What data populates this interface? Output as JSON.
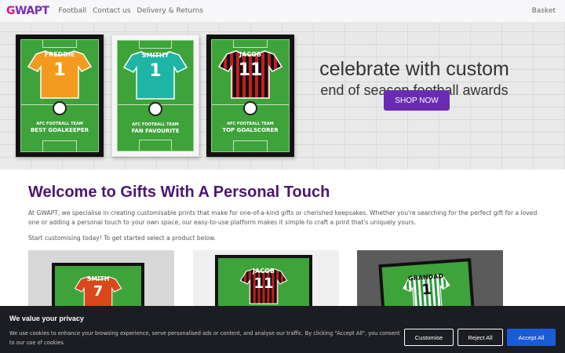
{
  "nav": {
    "logo_g": "G",
    "logo_rest": "WAPT",
    "links": [
      "Football",
      "Contact us",
      "Delivery & Returns"
    ],
    "basket": "Basket"
  },
  "hero": {
    "frames": [
      {
        "name": "FREDDIE",
        "number": "1",
        "team": "AFC FOOTBALL TEAM",
        "award": "BEST GOALKEEPER",
        "shirt_color": "#f39a1f",
        "frame": "black"
      },
      {
        "name": "SMITHY",
        "number": "1",
        "team": "AFC FOOTBALL TEAM",
        "award": "FAN FAVOURITE",
        "shirt_color": "#1fb5a6",
        "frame": "white"
      },
      {
        "name": "JACOB",
        "number": "11",
        "team": "AFC FOOTBALL TEAM",
        "award": "TOP GOALSCORER",
        "shirt_color": "#c0201f",
        "frame": "black"
      }
    ],
    "heading": "celebrate with custom",
    "subheading": "end of season football awards",
    "cta": "SHOP NOW"
  },
  "welcome": {
    "title": "Welcome to Gifts With A Personal Touch",
    "paragraph": "At GWAPT, we specialise in creating customisable prints that make for one-of-a-kind gifts or cherished keepsakes. Whether you're searching for the perfect gift for a loved one or adding a personal touch to your own space, our easy-to-use platform makes it simple to craft a print that's uniquely yours.",
    "paragraph2": "Start customising today! To get started select a product below."
  },
  "products": [
    {
      "name": "SMITH",
      "number": "7",
      "shirt_color": "#d9481d"
    },
    {
      "name": "JACOB",
      "number": "11",
      "shirt_color": "#c0201f"
    },
    {
      "name": "GRANDAD",
      "number": "1",
      "shirt_color": "#2c9b3d"
    }
  ],
  "cookie": {
    "title": "We value your privacy",
    "text": "We use cookies to enhance your browsing experience, serve personalised ads or content, and analyse our traffic. By clicking \"Accept All\", you consent to our use of cookies.",
    "customise": "Customise",
    "reject": "Reject All",
    "accept": "Accept All"
  },
  "colors": {
    "accent": "#6a2bb4",
    "title": "#4b1673",
    "accept": "#1a5bd6",
    "banner": "#1c1d22"
  }
}
